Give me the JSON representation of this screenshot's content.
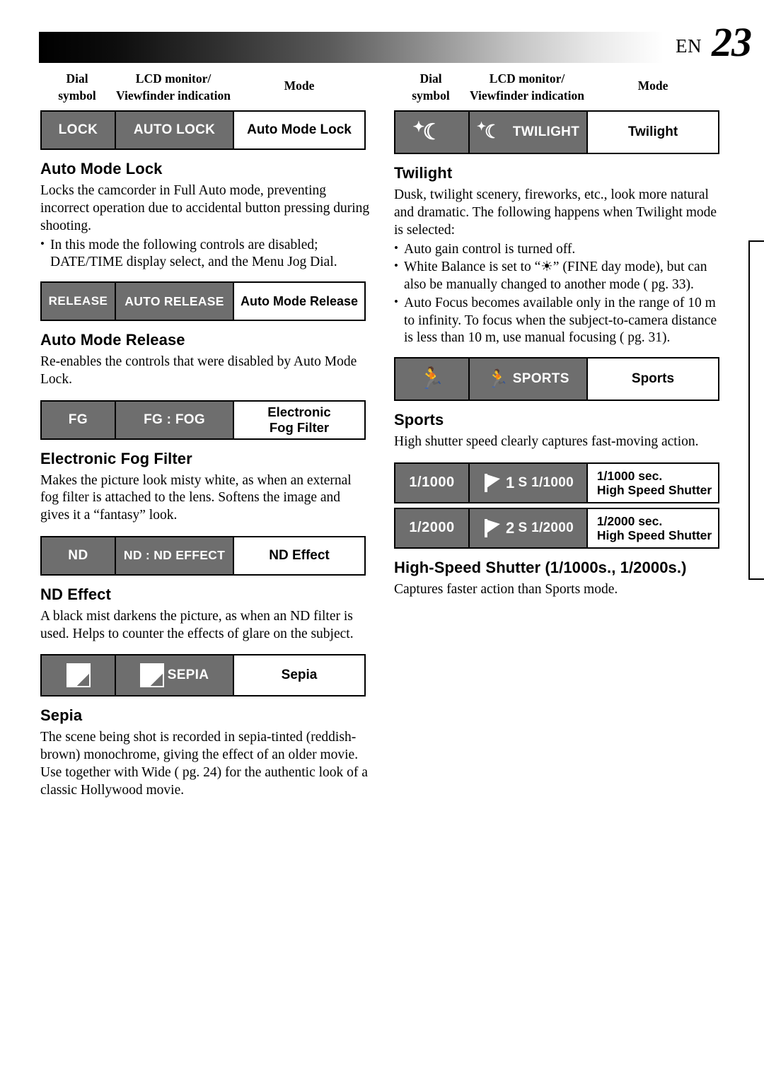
{
  "header": {
    "en_label": "EN",
    "page_number": "23"
  },
  "columns": {
    "head": {
      "dial_line1": "Dial",
      "dial_line2": "symbol",
      "lcd_line1": "LCD monitor/",
      "lcd_line2": "Viewfinder indication",
      "mode": "Mode"
    }
  },
  "left": {
    "rows": [
      {
        "symbol": "LOCK",
        "lcd": "AUTO LOCK",
        "mode": "Auto Mode Lock"
      },
      {
        "symbol": "RELEASE",
        "lcd": "AUTO RELEASE",
        "mode": "Auto Mode Release"
      },
      {
        "symbol": "FG",
        "lcd": "FG : FOG",
        "mode_l1": "Electronic",
        "mode_l2": "Fog Filter"
      },
      {
        "symbol": "ND",
        "lcd": "ND : ND EFFECT",
        "mode": "ND Effect"
      },
      {
        "symbol": "",
        "lcd": "SEPIA",
        "mode": "Sepia"
      }
    ],
    "sections": [
      {
        "title": "Auto Mode Lock",
        "paragraphs": [
          "Locks the camcorder in Full Auto mode, preventing incorrect operation due to accidental button pressing during shooting."
        ],
        "bullets": [
          "In this mode the following controls are disabled; DATE/TIME display select, and the Menu Jog Dial."
        ]
      },
      {
        "title": "Auto Mode Release",
        "paragraphs": [
          "Re-enables the controls that were disabled by Auto Mode Lock."
        ],
        "bullets": []
      },
      {
        "title": "Electronic Fog Filter",
        "paragraphs": [
          "Makes the picture look misty white, as when an external fog filter is attached to the lens. Softens the image and gives it a “fantasy” look."
        ],
        "bullets": []
      },
      {
        "title": "ND Effect",
        "paragraphs": [
          "A black mist darkens the picture, as when an ND filter is used. Helps to counter the effects of glare on the subject."
        ],
        "bullets": []
      },
      {
        "title": "Sepia",
        "paragraphs": [
          "The scene being shot is recorded in sepia-tinted (reddish-brown) monochrome, giving the effect of an older movie. Use together with Wide ( pg. 24) for the authentic look of a classic Hollywood movie."
        ],
        "bullets": []
      }
    ]
  },
  "right": {
    "rows": [
      {
        "symbol_icon": "moon-star-icon",
        "lcd": "TWILIGHT",
        "lcd_icon": "moon-star-icon",
        "mode": "Twilight"
      },
      {
        "symbol_icon": "runner-icon",
        "lcd": "SPORTS",
        "lcd_icon": "runner-icon",
        "mode": "Sports"
      },
      {
        "symbol": "1/1000",
        "lcd": "S 1/1000",
        "lcd_icon": "shutter-1-icon",
        "mode_l1": "1/1000 sec.",
        "mode_l2": "High Speed Shutter"
      },
      {
        "symbol": "1/2000",
        "lcd": "S 1/2000",
        "lcd_icon": "shutter-2-icon",
        "mode_l1": "1/2000 sec.",
        "mode_l2": "High Speed Shutter"
      }
    ],
    "sections": [
      {
        "title": "Twilight",
        "paragraphs": [
          "Dusk, twilight scenery, fireworks, etc., look more natural and dramatic. The following happens when Twilight mode is selected:"
        ],
        "bullets": [
          "Auto gain control is turned off.",
          "White Balance is set to “☀” (FINE day mode), but can also be manually changed to another mode ( pg. 33).",
          "Auto Focus becomes available only in the range of 10 m to infinity. To focus when the subject-to-camera distance is less than 10 m, use manual focusing ( pg. 31)."
        ]
      },
      {
        "title": "Sports",
        "paragraphs": [
          "High shutter speed clearly captures fast-moving action."
        ],
        "bullets": []
      },
      {
        "title": "High-Speed Shutter (1/1000s., 1/2000s.)",
        "paragraphs": [
          "Captures faster action than Sports mode."
        ],
        "bullets": []
      }
    ]
  }
}
